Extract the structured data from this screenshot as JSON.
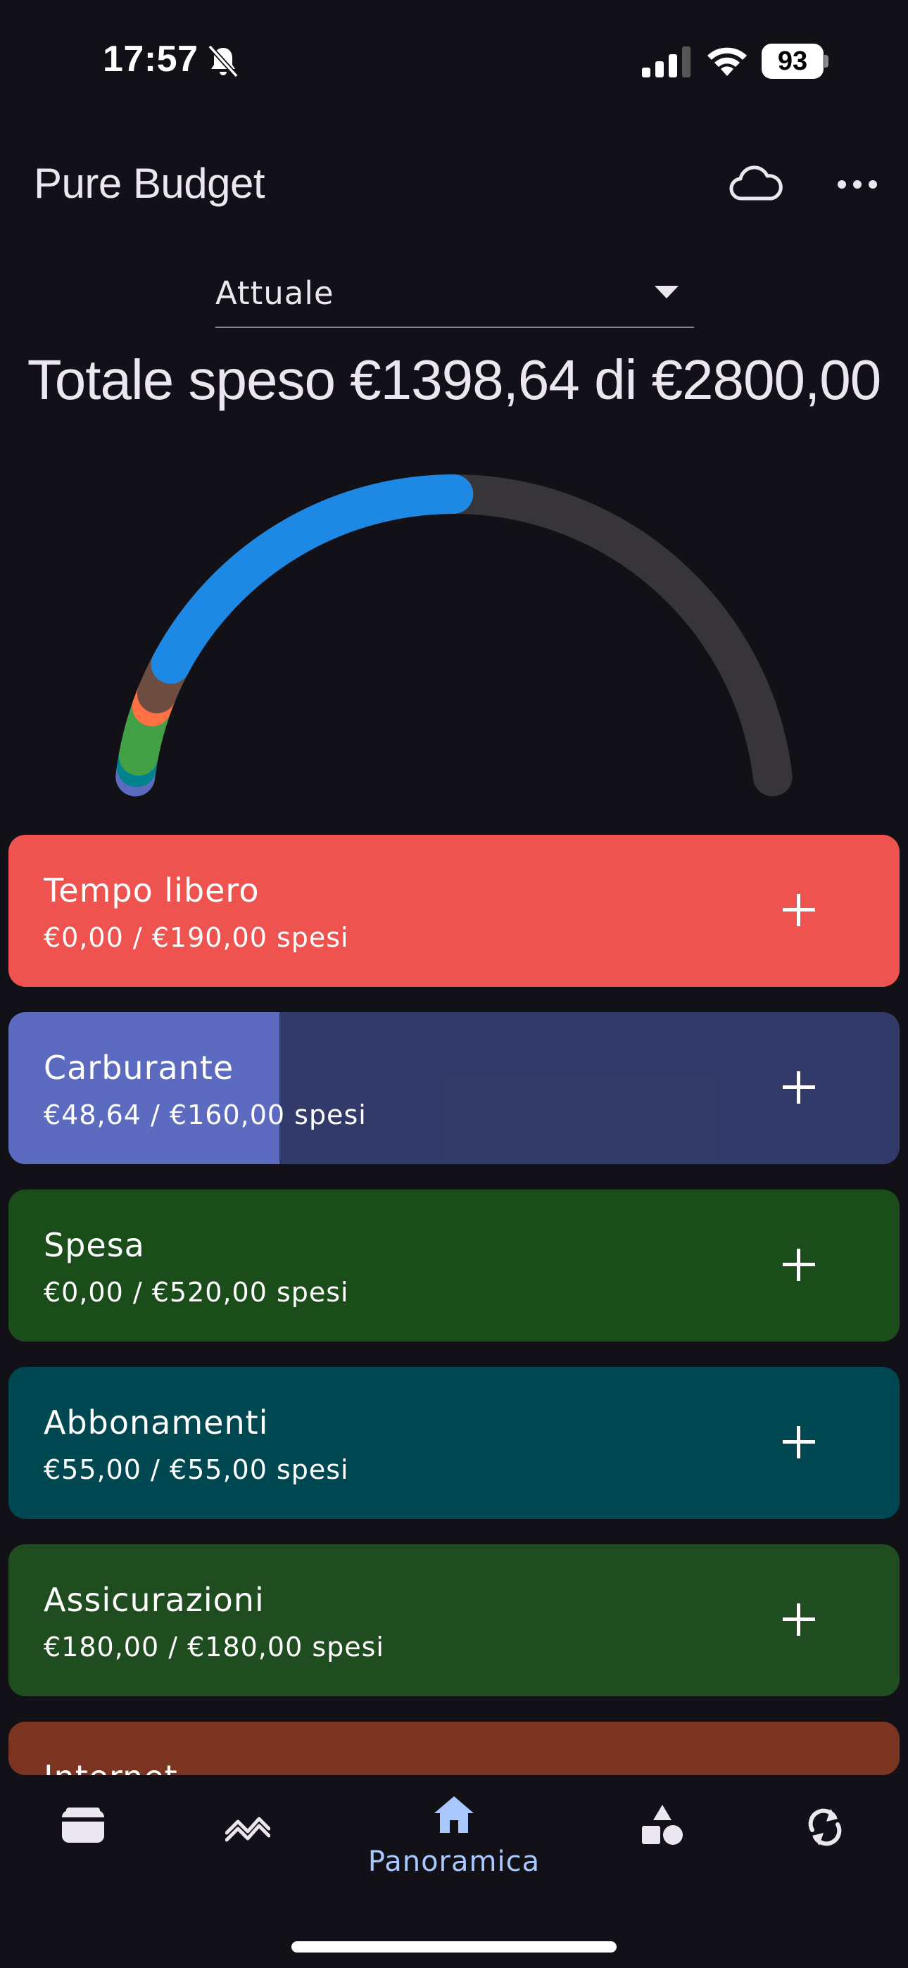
{
  "status_bar": {
    "time": "17:57",
    "battery": "93",
    "icons": [
      "bell-off-icon",
      "signal-icon",
      "wifi-icon",
      "battery-icon"
    ]
  },
  "app_bar": {
    "title": "Pure Budget",
    "icons": [
      "cloud-icon",
      "more-icon"
    ]
  },
  "period": {
    "selected": "Attuale"
  },
  "summary": {
    "total_text": "Totale speso €1398,64 di €2800,00",
    "spent": 1398.64,
    "budget": 2800.0
  },
  "colors": {
    "background": "#131118",
    "accent": "#A8C8FF",
    "gauge_track": "#37353A"
  },
  "categories": [
    {
      "name": "Tempo libero",
      "amount": "€0,00 / €190,00 spesi",
      "spent": 0,
      "budget": 190,
      "color": "#EF5350"
    },
    {
      "name": "Carburante",
      "amount": "€48,64 / €160,00 spesi",
      "spent": 48.64,
      "budget": 160,
      "color": "#5C6BC0"
    },
    {
      "name": "Spesa",
      "amount": "€0,00 / €520,00 spesi",
      "spent": 0,
      "budget": 520,
      "color": "#1B4D1B"
    },
    {
      "name": "Abbonamenti",
      "amount": "€55,00 / €55,00 spesi",
      "spent": 55,
      "budget": 55,
      "color": "#004851"
    },
    {
      "name": "Assicurazioni",
      "amount": "€180,00 / €180,00 spesi",
      "spent": 180,
      "budget": 180,
      "color": "#1F4D1F"
    },
    {
      "name": "Internet",
      "amount": "",
      "spent": 0,
      "budget": 0,
      "color": "#7A3420"
    }
  ],
  "bottom_nav": [
    {
      "icon": "wallet-icon",
      "label": ""
    },
    {
      "icon": "trend-icon",
      "label": ""
    },
    {
      "icon": "home-icon",
      "label": "Panoramica",
      "active": true
    },
    {
      "icon": "shapes-icon",
      "label": ""
    },
    {
      "icon": "sync-icon",
      "label": ""
    }
  ]
}
